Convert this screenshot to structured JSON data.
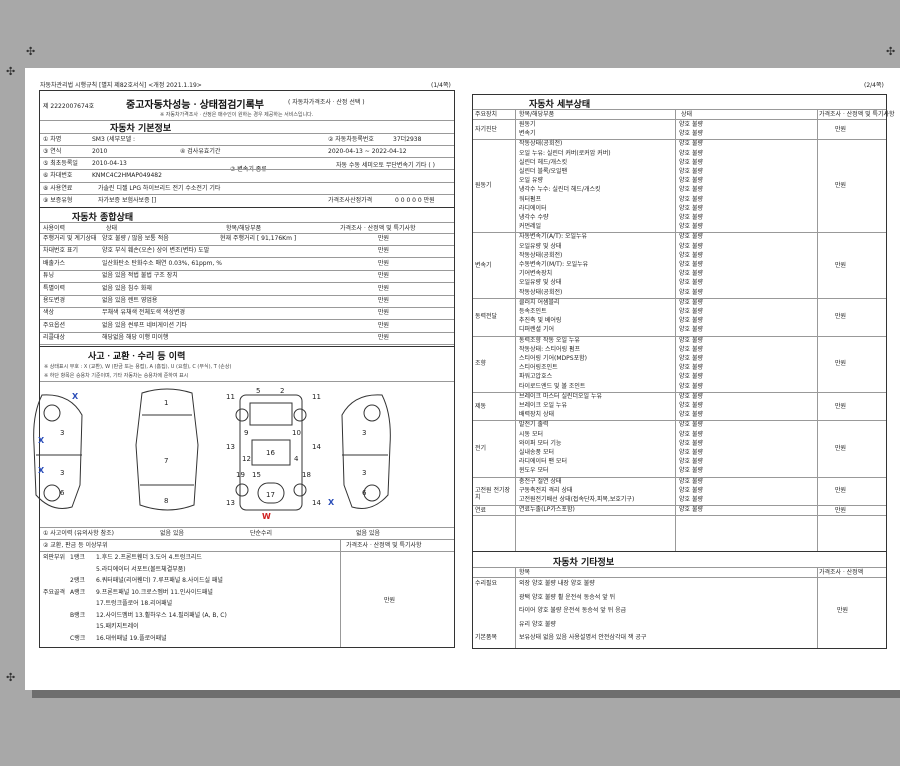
{
  "page_left": {
    "header": "자동차관리법 시행규칙 [별지 제82호서식] <개정 2021.1.19>",
    "page_no": "(1/4쪽)",
    "doc_no": "제 2222007674호",
    "title": "중고자동차성능ㆍ상태점검기록부",
    "title_note": "( 자동차가격조사ㆍ산정 선택 )",
    "sub_note": "※ 자동차가격조사ㆍ산정은 매수인이 원하는 경우 제공하는 서비스입니다.",
    "basic_title": "자동차 기본정보",
    "basic": {
      "car_label": "① 차명",
      "car_value": "SM3 (세부모델 :",
      "plate_label": "② 자동차등록번호",
      "plate_value": "37더2938",
      "year_label": "③ 연식",
      "year_value": "2010",
      "insp_label": "④ 검사유효기간",
      "insp_value": "2020-04-13 ~ 2022-04-12",
      "first_label": "⑤ 최초등록일",
      "first_value": "2010-04-13",
      "trans_label": "⑦ 변속기 종류",
      "trans_opts": "자동  수동  세미오토  무단변속기  기타 (  )",
      "vin_label": "⑥ 차대번호",
      "vin_value": "KNMC4C2HMAP049482",
      "fuel_label": "⑧ 사용연료",
      "fuel_opts": "가솔린  디젤  LPG  하이브리드  전기  수소전기  기타",
      "warranty_label": "⑨ 보증유형",
      "warranty_opts": "자가보증  보험사보증  []",
      "price_label": "가격조사산정가격",
      "price_value": "0 0 0 0 0 만원"
    },
    "summary_title": "자동차 종합상태",
    "summary_cols": [
      "사용이력",
      "상태",
      "항목/해당부품",
      "가격조사ㆍ산정액 및 특기사항"
    ],
    "summary_rows": [
      {
        "a": "주행거리 및 계기상태",
        "b": "양호  불량 / 많음  보통  적음",
        "c": "현재 주행거리 [ 91,176Km ]",
        "d": "만원"
      },
      {
        "a": "차대번호 표기",
        "b": "양호  부식  훼손(오손)  상이  변조(변타)  도말",
        "c": "",
        "d": "만원"
      },
      {
        "a": "배출가스",
        "b": "일산화탄소  탄화수소  매연 0.03%, 61ppm, %",
        "c": "",
        "d": "만원"
      },
      {
        "a": "튜닝",
        "b": "없음  있음  적법  불법  구조  장치",
        "c": "",
        "d": "만원"
      },
      {
        "a": "특별이력",
        "b": "없음  있음  침수  화재",
        "c": "",
        "d": "만원"
      },
      {
        "a": "용도변경",
        "b": "없음  있음  렌트  영업용",
        "c": "",
        "d": "만원"
      },
      {
        "a": "색상",
        "b": "무채색  유채색  전체도색  색상변경",
        "c": "",
        "d": "만원"
      },
      {
        "a": "주요옵션",
        "b": "없음  있음  썬루프  네비게이션  기타",
        "c": "",
        "d": "만원"
      },
      {
        "a": "리콜대상",
        "b": "해당없음  해당  이행  미이행",
        "c": "",
        "d": "만원"
      }
    ],
    "accident_title": "사고ㆍ교환ㆍ수리 등 이력",
    "accident_note1": "※ 상태표시 부호 : X (교환), W (판금 또는 용접), A (흠집), U (요철), C (부식), T (손상)",
    "accident_note2": "※ 하단 항목은 승용차 기준이며, 기타 자동차는 승용차에 준하여 표시",
    "accident_q1": "① 사고이력 (유의사항 참조)",
    "accident_q1_opts": "없음  있음",
    "accident_q2": "단순수리",
    "accident_q2_opts": "없음  있음",
    "exchange_title": "② 교환, 판금 등 이상부위",
    "exchange_col2": "가격조사ㆍ산정액 및 특기사항",
    "exchange_rows": [
      {
        "g": "외판부위",
        "r": "1랭크",
        "i": "1.후드  2.프론트휀더  3.도어  4.트렁크리드"
      },
      {
        "g": "",
        "r": "",
        "i": "5.라디에이터 서포트(볼트체결부품)"
      },
      {
        "g": "",
        "r": "2랭크",
        "i": "6.쿼터패널(리어휀더)  7.루프패널  8.사이드실 패널"
      },
      {
        "g": "주요골격",
        "r": "A랭크",
        "i": "9.프론트패널  10.크로스멤버  11.인사이드패널"
      },
      {
        "g": "",
        "r": "",
        "i": "17.트렁크플로어  18.리어패널"
      },
      {
        "g": "",
        "r": "B랭크",
        "i": "12.사이드멤버  13.휠하우스  14.필러패널 (A, B, C)"
      },
      {
        "g": "",
        "r": "",
        "i": "15.패키지트레이"
      },
      {
        "g": "",
        "r": "C랭크",
        "i": "16.대쉬패널  19.플로어패널"
      }
    ],
    "exchange_price": "만원",
    "diagram_labels": [
      "1",
      "2",
      "3",
      "4",
      "5",
      "6",
      "7",
      "8",
      "9",
      "10",
      "11",
      "12",
      "13",
      "14",
      "15",
      "16",
      "17",
      "18",
      "19"
    ],
    "mark_x": "X",
    "mark_w": "W"
  },
  "page_right": {
    "page_no": "(2/4쪽)",
    "detail_title": "자동차 세부상태",
    "detail_cols": [
      "주요장치",
      "항목/해당부품",
      "상태",
      "가격조사ㆍ산정액 및 특기사항"
    ],
    "groups": [
      {
        "name": "자기진단",
        "items": [
          "원동기",
          "변속기"
        ]
      },
      {
        "name": "원동기",
        "items": [
          "작동상태(공회전)",
          "오일 누유: 실린더 커버(로커암 커버)",
          "실린더 헤드/개스킷",
          "실린더 블록/오일팬",
          "오일 유량",
          "냉각수 누수: 실린더 헤드/개스킷",
          "워터펌프",
          "라디에이터",
          "냉각수 수량",
          "커먼레일"
        ]
      },
      {
        "name": "변속기",
        "items": [
          "자동변속기(A/T): 오일누유",
          "오일유량 및 상태",
          "작동상태(공회전)",
          "수동변속기(M/T): 오일누유",
          "기어변속장치",
          "오일유량 및 상태",
          "작동상태(공회전)"
        ]
      },
      {
        "name": "동력전달",
        "items": [
          "클러치 어셈블리",
          "등속조인트",
          "추진축 및 베어링",
          "디퍼렌셜 기어"
        ]
      },
      {
        "name": "조향",
        "items": [
          "동력조향 작동 오일 누유",
          "작동상태: 스티어링 펌프",
          "스티어링 기어(MDPS포함)",
          "스티어링조인트",
          "파워고압호스",
          "타이로드엔드 및 볼 조인트"
        ]
      },
      {
        "name": "제동",
        "items": [
          "브레이크 마스터 실린더오일 누유",
          "브레이크 오일 누유",
          "배력장치 상태"
        ]
      },
      {
        "name": "전기",
        "items": [
          "발전기 출력",
          "시동 모터",
          "와이퍼 모터 기능",
          "실내송풍 모터",
          "라디에이터 팬 모터",
          "윈도우 모터"
        ]
      },
      {
        "name": "고전원 전기장치",
        "items": [
          "충전구 절연 상태",
          "구동축전지 격리 상태",
          "고전원전기배선 상태(접속단자,피복,보호기구)"
        ]
      },
      {
        "name": "연료",
        "items": [
          "연료누출(LP가스포함)"
        ]
      }
    ],
    "status_opts": "양호  불량",
    "price_unit": "만원",
    "other_title": "자동차 기타정보",
    "other_cols": [
      "항목",
      "",
      "가격조사ㆍ산정액"
    ],
    "other_rows": [
      {
        "g": "수리필요",
        "i": "외장  양호  불량   내장  양호  불량"
      },
      {
        "g": "",
        "i": "광택  양호  불량   휠  운전석 동승석 앞 뒤"
      },
      {
        "g": "",
        "i": "타이어  양호  불량   운전석 동승석 앞 뒤 응급"
      },
      {
        "g": "",
        "i": "유리  양호  불량"
      },
      {
        "g": "기본품목",
        "i": "보유상태  없음  있음  사용설명서  안전삼각대  잭  공구"
      }
    ],
    "other_price": "만원"
  }
}
